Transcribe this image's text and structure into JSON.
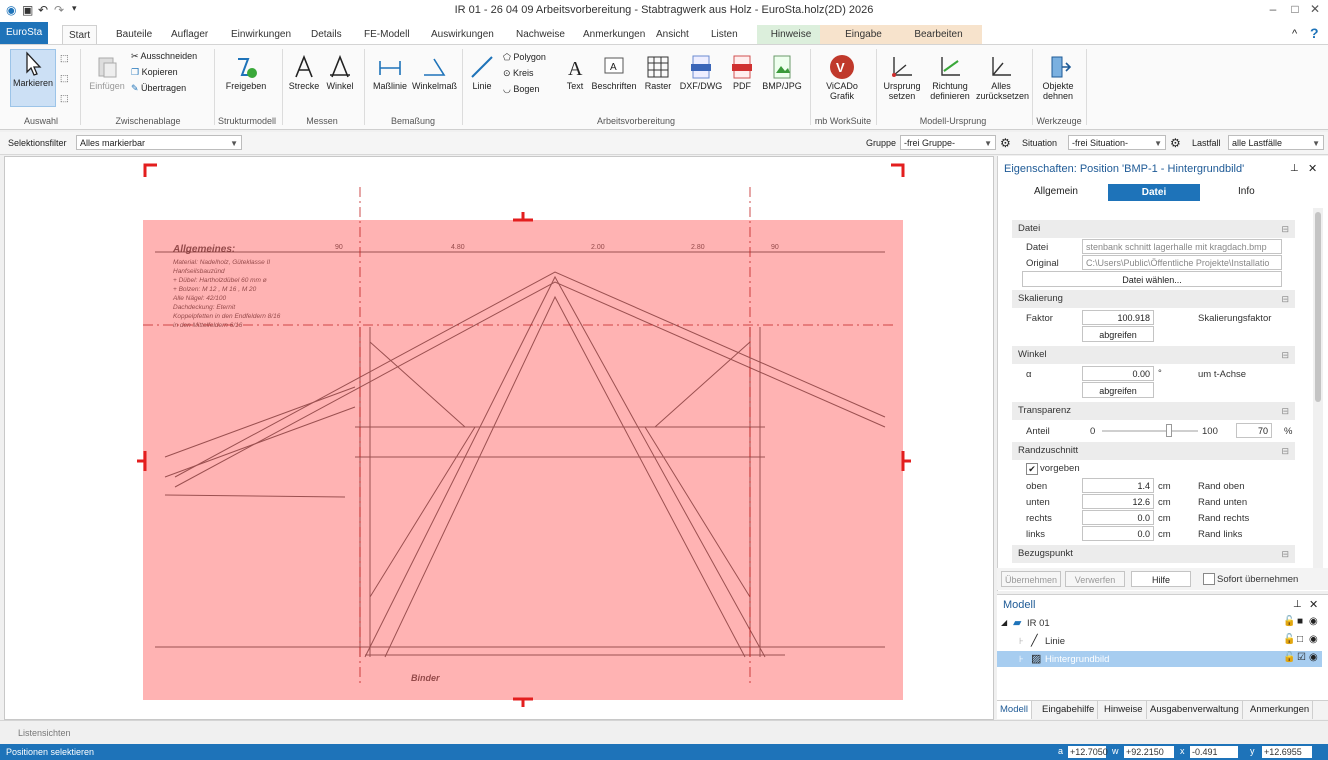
{
  "window": {
    "title": "IR 01 - 26 04 09 Arbeitsvorbereitung - Stabtragwerk aus Holz - EuroSta.holz(2D) 2026",
    "help": "?",
    "collapse": "^"
  },
  "tabs": [
    "EuroSta",
    "Start",
    "Bauteile",
    "Auflager",
    "Einwirkungen",
    "Details",
    "FE-Modell",
    "Auswirkungen",
    "Nachweise",
    "Anmerkungen",
    "Ansicht",
    "Listen",
    "Hinweise",
    "Eingabe",
    "Bearbeiten"
  ],
  "ribbon": {
    "auswahl": {
      "label": "Auswahl",
      "markieren": "Markieren"
    },
    "zwischenablage": {
      "label": "Zwischenablage",
      "einfuegen": "Einfügen",
      "ausschneiden": "Ausschneiden",
      "kopieren": "Kopieren",
      "uebertragen": "Übertragen"
    },
    "strukturmodell": {
      "label": "Strukturmodell",
      "freigeben": "Freigeben"
    },
    "messen": {
      "label": "Messen",
      "strecke": "Strecke",
      "winkel": "Winkel"
    },
    "bemassung": {
      "label": "Bemaßung",
      "masslinie": "Maßlinie",
      "winkelmass": "Winkelmaß"
    },
    "arbeitsvorbereitung": {
      "label": "Arbeitsvorbereitung",
      "linie": "Linie",
      "polygon": "Polygon",
      "kreis": "Kreis",
      "bogen": "Bogen",
      "text": "Text",
      "beschriften": "Beschriften",
      "raster": "Raster",
      "dxf": "DXF/DWG",
      "pdf": "PDF",
      "bmp": "BMP/JPG"
    },
    "worksuite": {
      "label": "mb WorkSuite",
      "vicado1": "ViCADo",
      "vicado2": "Grafik"
    },
    "modellursprung": {
      "label": "Modell-Ursprung",
      "ursprung1": "Ursprung",
      "ursprung2": "setzen",
      "richtung1": "Richtung",
      "richtung2": "definieren",
      "alles1": "Alles",
      "alles2": "zurücksetzen"
    },
    "werkzeuge": {
      "label": "Werkzeuge",
      "objekte1": "Objekte",
      "objekte2": "dehnen"
    }
  },
  "filterbar": {
    "selektionsfilter_label": "Selektionsfilter",
    "selektionsfilter_value": "Alles markierbar",
    "gruppe_label": "Gruppe",
    "gruppe_value": "-frei Gruppe-",
    "situation_label": "Situation",
    "situation_value": "-frei Situation-",
    "lastfall_label": "Lastfall",
    "lastfall_value": "alle Lastfälle"
  },
  "drawing": {
    "heading": "Allgemeines:",
    "notes": [
      "Material:   Nadelholz, Güteklasse II",
      "            Hanfseilsbauzünd",
      "+ Dübel:    Hartholzdübel 60 mm ø",
      "+ Bolzen:   M 12 , M 16 , M 20",
      "Alle Nägel:  42/100",
      "Dachdeckung: Eternit",
      "Koppelpfetten in den Endfeldern 8/16",
      "              in den Mittelfeldern 6/16"
    ],
    "binder": "Binder",
    "dims": [
      "90",
      "4.80",
      "2.00",
      "2.80",
      "90"
    ]
  },
  "props": {
    "title": "Eigenschaften: Position 'BMP-1 - Hintergrundbild'",
    "tabs": [
      "Allgemein",
      "Datei",
      "Info"
    ],
    "datei": {
      "section": "Datei",
      "datei_label": "Datei",
      "datei_value": "stenbank schnitt lagerhalle mit kragdach.bmp",
      "original_label": "Original",
      "original_value": "C:\\Users\\Public\\Öffentliche Projekte\\Installatio",
      "button": "Datei wählen..."
    },
    "skalierung": {
      "section": "Skalierung",
      "faktor_label": "Faktor",
      "faktor_value": "100.918",
      "faktor_desc": "Skalierungsfaktor",
      "button": "abgreifen"
    },
    "winkel": {
      "section": "Winkel",
      "alpha_label": "α",
      "alpha_value": "0.00",
      "alpha_unit": "°",
      "alpha_desc": "um t-Achse",
      "button": "abgreifen"
    },
    "transparenz": {
      "section": "Transparenz",
      "anteil_label": "Anteil",
      "min": "0",
      "max": "100",
      "value": "70",
      "unit": "%",
      "fraction": 0.7
    },
    "randzuschnitt": {
      "section": "Randzuschnitt",
      "vorgeben": "vorgeben",
      "rows": [
        {
          "label": "oben",
          "value": "1.4",
          "unit": "cm",
          "desc": "Rand oben"
        },
        {
          "label": "unten",
          "value": "12.6",
          "unit": "cm",
          "desc": "Rand unten"
        },
        {
          "label": "rechts",
          "value": "0.0",
          "unit": "cm",
          "desc": "Rand rechts"
        },
        {
          "label": "links",
          "value": "0.0",
          "unit": "cm",
          "desc": "Rand links"
        }
      ]
    },
    "bezugspunkt": {
      "section": "Bezugspunkt"
    },
    "buttons": {
      "uebernehmen": "Übernehmen",
      "verwerfen": "Verwerfen",
      "hilfe": "Hilfe",
      "sofort": "Sofort übernehmen"
    }
  },
  "model": {
    "title": "Modell",
    "items": [
      {
        "label": "IR 01"
      },
      {
        "label": "Linie"
      },
      {
        "label": "Hintergrundbild"
      }
    ],
    "tabs": [
      "Modell",
      "Eingabehilfe",
      "Hinweise",
      "Ausgabenverwaltung",
      "Anmerkungen"
    ]
  },
  "listbar": {
    "label": "Listensichten"
  },
  "status": {
    "text": "Positionen selektieren",
    "a_label": "a",
    "a_value": "+12.7050",
    "w_label": "w",
    "w_value": "+92.2150",
    "x_label": "x",
    "x_value": "-0.491",
    "y_label": "y",
    "y_value": "+12.6955"
  },
  "colors": {
    "accent": "#1e73b9",
    "overlay": "#ff9a9a",
    "marker": "#e31e1e",
    "contextGreen": "#dcefdc",
    "contextOrange": "#f7e3cc"
  }
}
